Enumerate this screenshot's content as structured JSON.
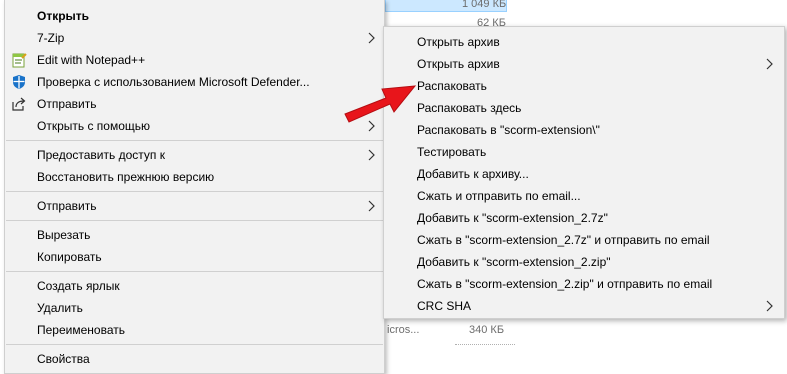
{
  "background": {
    "size_top": "1 049 КБ",
    "size_second": "62 КБ",
    "filename_fragment": "icros...",
    "size_bottom": "340 КБ"
  },
  "context_menu": {
    "items": [
      {
        "label": "Открыть",
        "bold": true
      },
      {
        "label": "7-Zip",
        "has_submenu": true
      },
      {
        "label": "Edit with Notepad++",
        "icon": "notepadpp-icon"
      },
      {
        "label": "Проверка с использованием Microsoft Defender...",
        "icon": "defender-shield-icon"
      },
      {
        "label": "Отправить",
        "icon": "share-icon"
      },
      {
        "label": "Открыть с помощью",
        "has_submenu": true
      },
      {
        "label": "Предоставить доступ к",
        "has_submenu": true
      },
      {
        "label": "Восстановить прежнюю версию"
      },
      {
        "label": "Отправить",
        "has_submenu": true
      },
      {
        "label": "Вырезать"
      },
      {
        "label": "Копировать"
      },
      {
        "label": "Создать ярлык"
      },
      {
        "label": "Удалить"
      },
      {
        "label": "Переименовать"
      },
      {
        "label": "Свойства"
      }
    ]
  },
  "submenu_7zip": {
    "items": [
      {
        "label": "Открыть архив"
      },
      {
        "label": "Открыть архив",
        "has_submenu": true
      },
      {
        "label": "Распаковать"
      },
      {
        "label": "Распаковать здесь"
      },
      {
        "label": "Распаковать в \"scorm-extension\\\""
      },
      {
        "label": "Тестировать"
      },
      {
        "label": "Добавить к архиву..."
      },
      {
        "label": "Сжать и отправить по email..."
      },
      {
        "label": "Добавить к \"scorm-extension_2.7z\""
      },
      {
        "label": "Сжать в \"scorm-extension_2.7z\" и отправить по email"
      },
      {
        "label": "Добавить к \"scorm-extension_2.zip\""
      },
      {
        "label": "Сжать в \"scorm-extension_2.zip\" и отправить по email"
      },
      {
        "label": "CRC SHA",
        "has_submenu": true
      }
    ]
  },
  "colors": {
    "menu_bg": "#f2f2f2",
    "separator": "#d0d0d0",
    "annotation_arrow": "#e8151b"
  }
}
